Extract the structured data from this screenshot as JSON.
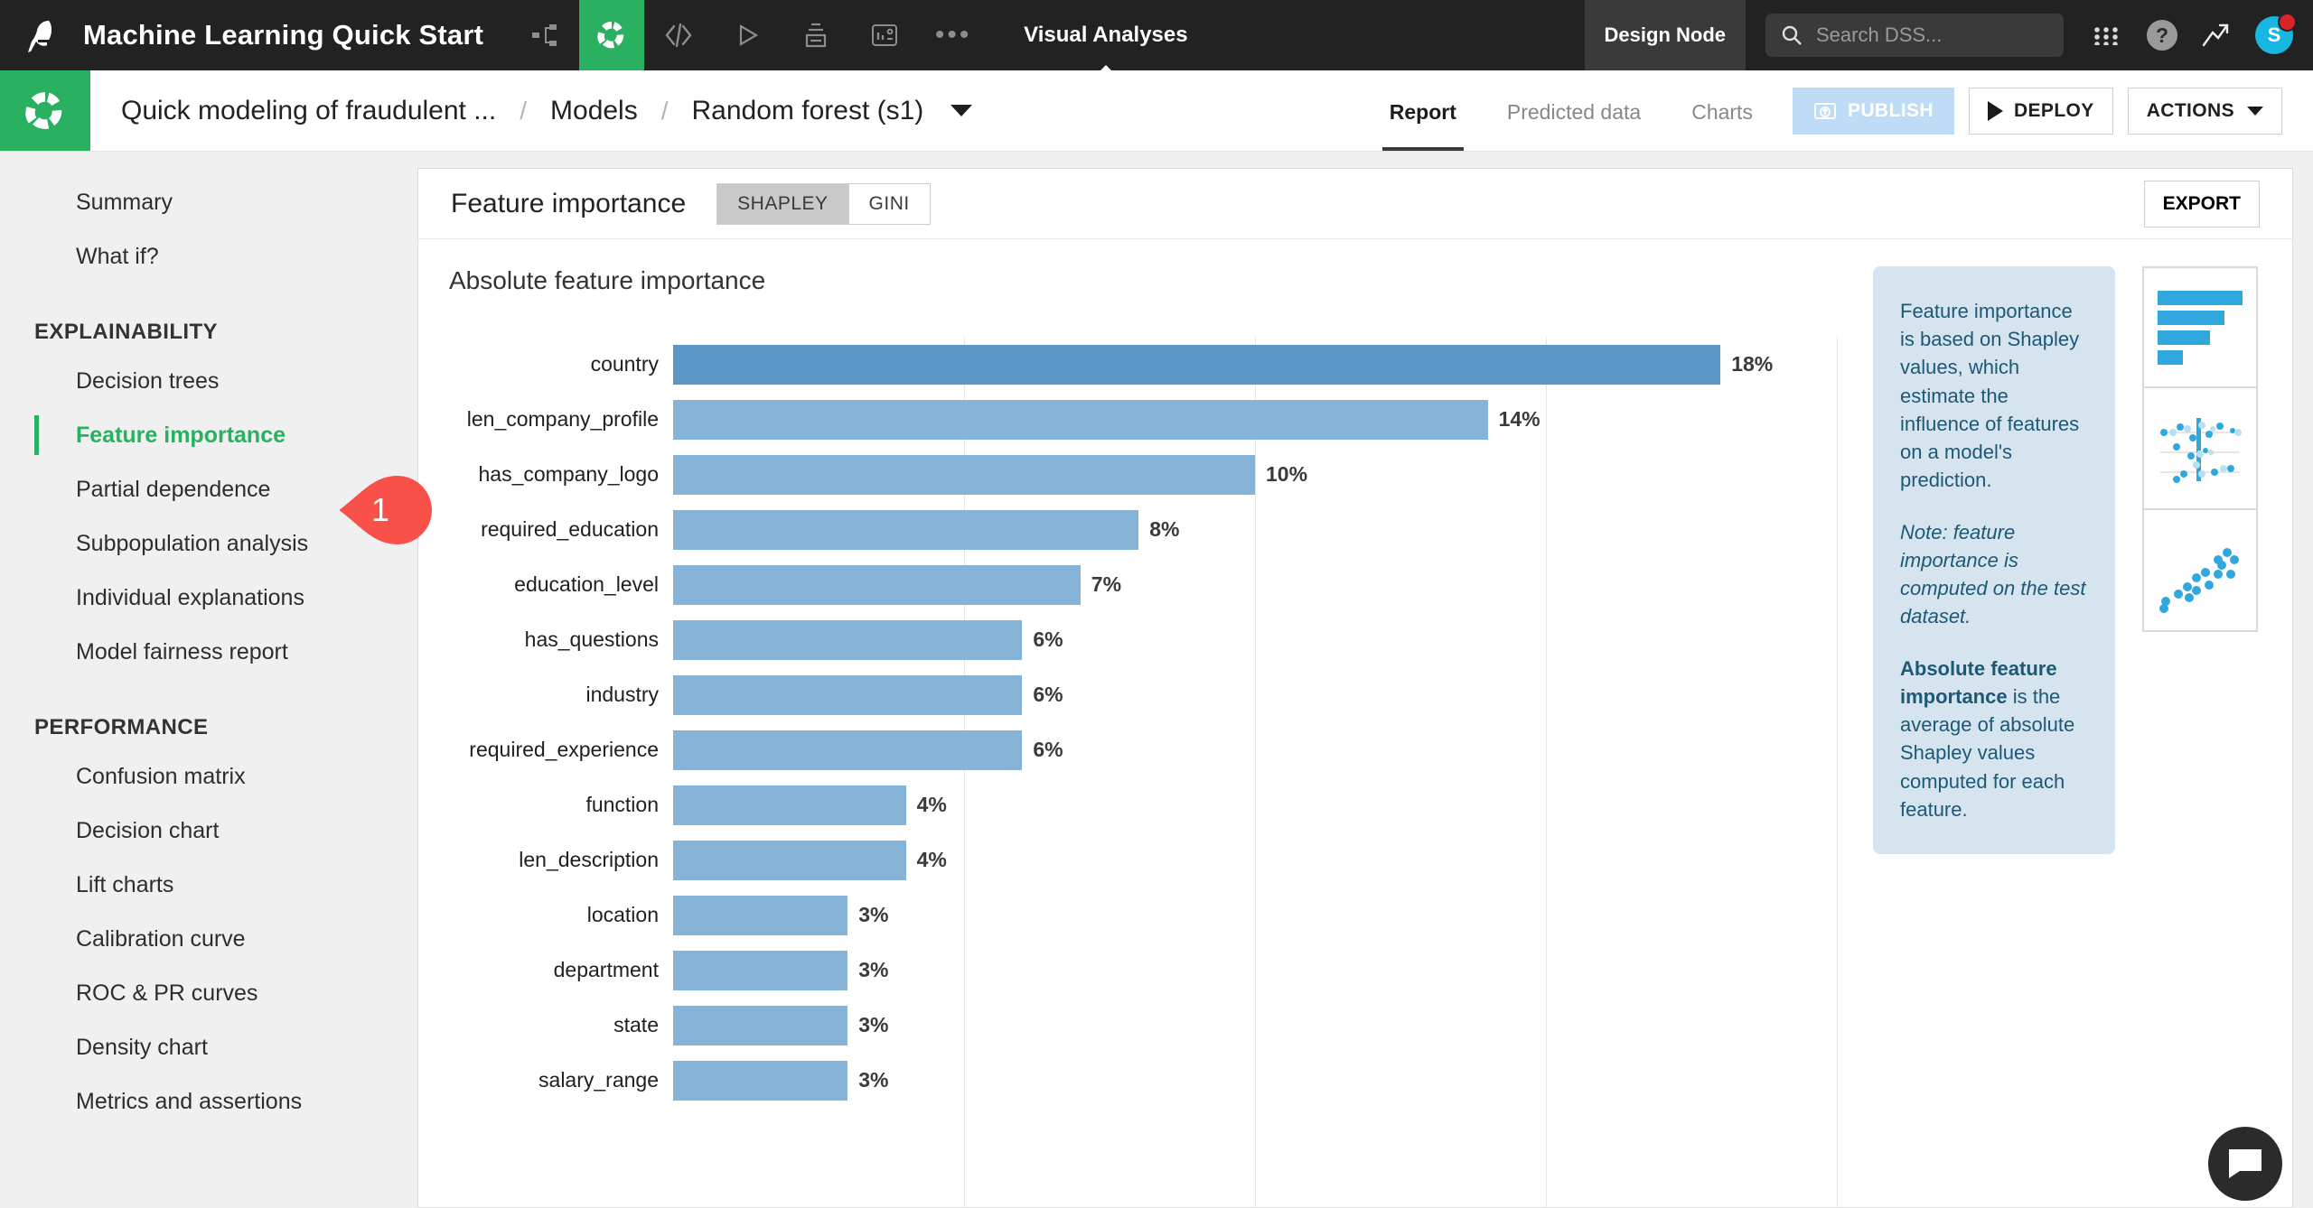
{
  "topbar": {
    "logo_icon": "bird-logo-icon",
    "title": "Machine Learning Quick Start",
    "icons": [
      {
        "name": "share-flow-icon",
        "glyph": "share"
      },
      {
        "name": "flow-active-icon",
        "glyph": "dss-logo"
      },
      {
        "name": "code-icon",
        "glyph": "</>"
      },
      {
        "name": "run-icon",
        "glyph": "play"
      },
      {
        "name": "jobs-icon",
        "glyph": "jobs"
      },
      {
        "name": "dashboard-icon",
        "glyph": "dashboard"
      },
      {
        "name": "more-icon",
        "glyph": "•••"
      }
    ],
    "section_label": "Visual Analyses",
    "design_node_label": "Design Node",
    "search": {
      "placeholder": "Search DSS...",
      "value": ""
    },
    "apps_icon": "apps-grid-icon",
    "help_icon": "help-icon",
    "help_glyph": "?",
    "trend_icon": "trending-up-icon",
    "avatar_initial": "S",
    "notification_color": "#d9222a"
  },
  "breadcrumb": {
    "project_icon": "project-logo-icon",
    "items": [
      {
        "label": "Quick modeling of fraudulent ..."
      },
      {
        "label": "Models"
      },
      {
        "label": "Random forest (s1)"
      }
    ],
    "separator": "/",
    "dropdown_icon": "chevron-down-icon"
  },
  "header_actions": {
    "tabs": [
      {
        "label": "Report",
        "active": true
      },
      {
        "label": "Predicted data",
        "active": false
      },
      {
        "label": "Charts",
        "active": false
      }
    ],
    "publish_label": "PUBLISH",
    "publish_icon": "publish-icon",
    "deploy_label": "DEPLOY",
    "deploy_icon": "play-icon",
    "actions_label": "ACTIONS",
    "actions_icon": "chevron-down-icon"
  },
  "sidebar": {
    "items": [
      {
        "label": "Summary",
        "active": false
      },
      {
        "label": "What if?",
        "active": false
      }
    ],
    "groups": [
      {
        "heading": "EXPLAINABILITY",
        "items": [
          {
            "label": "Decision trees",
            "active": false
          },
          {
            "label": "Feature importance",
            "active": true
          },
          {
            "label": "Partial dependence",
            "active": false
          },
          {
            "label": "Subpopulation analysis",
            "active": false
          },
          {
            "label": "Individual explanations",
            "active": false
          },
          {
            "label": "Model fairness report",
            "active": false
          }
        ]
      },
      {
        "heading": "PERFORMANCE",
        "items": [
          {
            "label": "Confusion matrix",
            "active": false
          },
          {
            "label": "Decision chart",
            "active": false
          },
          {
            "label": "Lift charts",
            "active": false
          },
          {
            "label": "Calibration curve",
            "active": false
          },
          {
            "label": "ROC & PR curves",
            "active": false
          },
          {
            "label": "Density chart",
            "active": false
          },
          {
            "label": "Metrics and assertions",
            "active": false
          }
        ]
      }
    ],
    "callout": {
      "number": "1",
      "color": "#f9514a"
    }
  },
  "panel": {
    "title": "Feature importance",
    "toggle": [
      {
        "label": "SHAPLEY",
        "selected": true
      },
      {
        "label": "GINI",
        "selected": false
      }
    ],
    "export_label": "EXPORT",
    "export_icon": "chevron-down-icon"
  },
  "info_panel": {
    "background": "#d5e4ee",
    "text_color": "#1d5877",
    "paragraphs": [
      {
        "style": "normal",
        "text": "Feature importance is based on Shapley values, which estimate the influence of features on a model's prediction."
      },
      {
        "style": "italic",
        "text": "Note: feature importance is computed on the test dataset."
      },
      {
        "style": "mixed",
        "bold_lead": "Absolute feature importance",
        "text": " is the average of absolute Shapley values computed for each feature."
      }
    ]
  },
  "thumbnails": [
    {
      "name": "thumb-bar-chart"
    },
    {
      "name": "thumb-beeswarm-chart"
    },
    {
      "name": "thumb-scatter-chart"
    }
  ],
  "chart_data": {
    "type": "bar",
    "orientation": "horizontal",
    "title": "Absolute feature importance",
    "xlabel": "",
    "ylabel": "",
    "xlim": [
      0,
      20
    ],
    "grid": true,
    "value_suffix": "%",
    "bar_color": "#85b4d8",
    "bar_color_top": "#5b96c4",
    "legend": "none",
    "categories": [
      "country",
      "len_company_profile",
      "has_company_logo",
      "required_education",
      "education_level",
      "has_questions",
      "industry",
      "required_experience",
      "function",
      "len_description",
      "location",
      "department",
      "state",
      "salary_range"
    ],
    "values": [
      18,
      14,
      10,
      8,
      7,
      6,
      6,
      6,
      4,
      4,
      3,
      3,
      3,
      3
    ],
    "labels": [
      "18%",
      "14%",
      "10%",
      "8%",
      "7%",
      "6%",
      "6%",
      "6%",
      "4%",
      "4%",
      "3%",
      "3%",
      "3%",
      "3%"
    ]
  },
  "chat_button": {
    "name": "support-chat-button",
    "icon": "chat-bubble-icon"
  }
}
